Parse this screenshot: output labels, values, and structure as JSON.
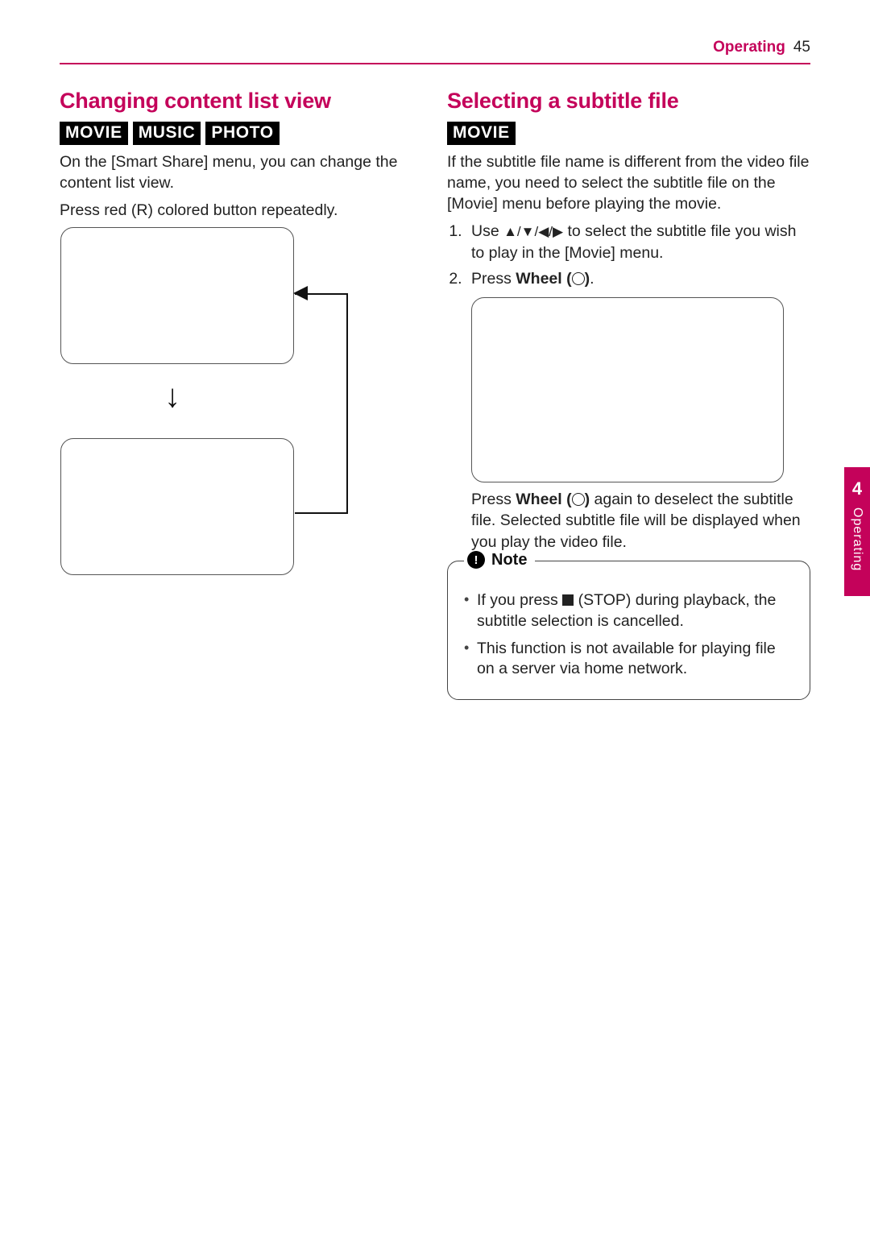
{
  "header": {
    "section": "Operating",
    "page": "45"
  },
  "sideTab": {
    "chapter": "4",
    "label": "Operating"
  },
  "left": {
    "title": "Changing content list view",
    "tags": [
      "MOVIE",
      "MUSIC",
      "PHOTO"
    ],
    "intro": "On the [Smart Share] menu, you can change the content list view.",
    "instruction": "Press red (R) colored button repeatedly."
  },
  "right": {
    "title": "Selecting a subtitle file",
    "tags": [
      "MOVIE"
    ],
    "intro": "If the subtitle file name is different from the video file name, you need to select the subtitle file on the [Movie] menu before playing the movie.",
    "step1_prefix": "Use ",
    "step1_suffix": " to select the subtitle file you wish to play in the [Movie] menu.",
    "step2_prefix": "Press ",
    "step2_wheel": "Wheel (",
    "step2_close": ")",
    "step2_end": ".",
    "after_prefix": "Press ",
    "after_wheel": "Wheel (",
    "after_close": ")",
    "after_suffix": " again to deselect the subtitle file. Selected subtitle file will be displayed when you play the video file.",
    "note_label": "Note",
    "note_items": {
      "n1_prefix": "If you press ",
      "n1_suffix": " (STOP) during playback, the subtitle selection is cancelled.",
      "n2": "This function is not available for playing file on a server via home network."
    }
  }
}
